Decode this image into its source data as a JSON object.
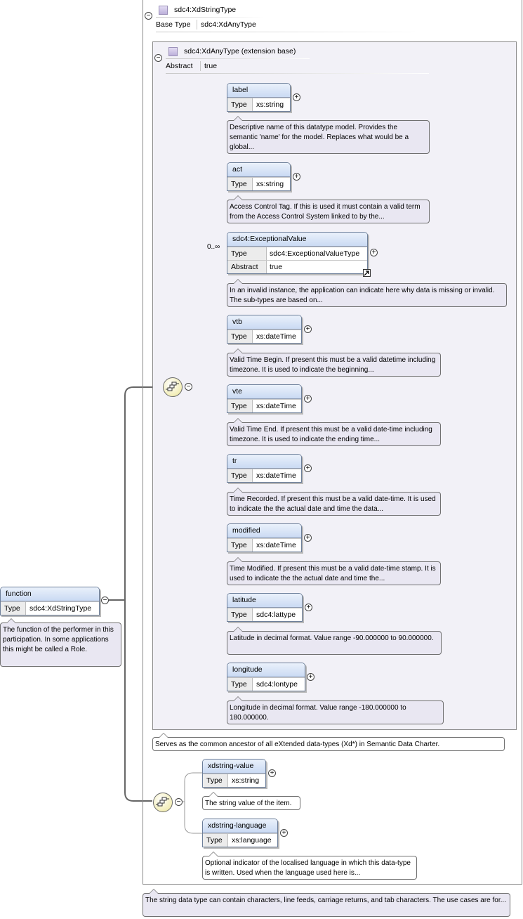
{
  "root": {
    "name": "function",
    "type_label": "Type",
    "type_value": "sdc4:XdStringType",
    "note": "The function of the performer in this participation. In some applications this might be called a Role."
  },
  "complex_type": {
    "name": "sdc4:XdStringType",
    "base_type_label": "Base Type",
    "base_type_value": "sdc4:XdAnyType",
    "note": "The string data type can contain characters, line feeds, carriage returns, and tab characters. The use cases are for..."
  },
  "extension": {
    "name": "sdc4:XdAnyType (extension base)",
    "abstract_label": "Abstract",
    "abstract_value": "true",
    "note": "Serves as the common ancestor of all eXtended data-types (Xd*) in Semantic Data Charter."
  },
  "elements": [
    {
      "name": "label",
      "type_label": "Type",
      "type": "xs:string",
      "note": "Descriptive name of this datatype model. Provides the semantic 'name' for the model. Replaces what would be a global..."
    },
    {
      "name": "act",
      "type_label": "Type",
      "type": "xs:string",
      "note": "Access Control Tag. If this is used it must contain a valid term from the Access Control System linked to by the..."
    },
    {
      "name": "sdc4:ExceptionalValue",
      "type_label": "Type",
      "type": "sdc4:ExceptionalValueType",
      "abstract_label": "Abstract",
      "abstract": "true",
      "multiplicity": "0..∞",
      "note": "In an invalid instance, the application can indicate here why data is missing or invalid. The sub-types are based on..."
    },
    {
      "name": "vtb",
      "type_label": "Type",
      "type": "xs:dateTime",
      "note": "Valid Time Begin. If present this must be a valid datetime including timezone. It is used to indicate the beginning..."
    },
    {
      "name": "vte",
      "type_label": "Type",
      "type": "xs:dateTime",
      "note": "Valid Time End. If present this must be a valid date-time including timezone. It is used to indicate the ending time..."
    },
    {
      "name": "tr",
      "type_label": "Type",
      "type": "xs:dateTime",
      "note": "Time Recorded. If present this must be a valid date-time. It is used to indicate the the actual date and time the data..."
    },
    {
      "name": "modified",
      "type_label": "Type",
      "type": "xs:dateTime",
      "note": "Time Modified. If present this must be a valid date-time stamp. It is used to indicate the the actual date and time the..."
    },
    {
      "name": "latitude",
      "type_label": "Type",
      "type": "sdc4:lattype",
      "note": "Latitude in decimal format. Value range -90.000000 to 90.000000."
    },
    {
      "name": "longitude",
      "type_label": "Type",
      "type": "sdc4:lontype",
      "note": "Longitude in decimal format. Value range -180.000000 to 180.000000."
    }
  ],
  "string_elements": [
    {
      "name": "xdstring-value",
      "type_label": "Type",
      "type": "xs:string",
      "note": "The string value of the item."
    },
    {
      "name": "xdstring-language",
      "type_label": "Type",
      "type": "xs:language",
      "note": "Optional indicator of the localised language in which this data-type is written. Used when the language used here is..."
    }
  ],
  "icons": {
    "collapse": "minus-circle-icon",
    "expand": "plus-circle-icon",
    "sequence": "sequence-compositor-icon",
    "complex_type": "complex-type-square-icon",
    "open_type": "open-type-arrow-icon"
  },
  "colors": {
    "element_header": "#cadaf3",
    "note_background": "#e9e7f2",
    "extension_background": "#f2f1f7",
    "connector": "#555555"
  }
}
